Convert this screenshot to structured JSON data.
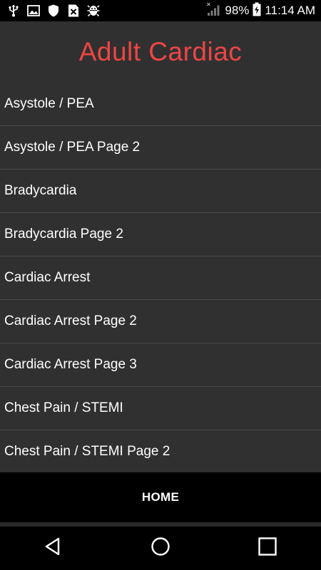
{
  "status_bar": {
    "icons_left": [
      "usb-icon",
      "image-icon",
      "shield-icon",
      "close-box-icon",
      "android-debug-icon"
    ],
    "signal_icon": "signal-icon",
    "battery_percent": "98%",
    "battery_icon": "battery-charging-icon",
    "time": "11:14 AM"
  },
  "header": {
    "title": "Adult Cardiac",
    "title_color": "#ef4545"
  },
  "list": {
    "items": [
      {
        "label": "Asystole / PEA"
      },
      {
        "label": "Asystole / PEA Page 2"
      },
      {
        "label": "Bradycardia"
      },
      {
        "label": "Bradycardia Page 2"
      },
      {
        "label": "Cardiac Arrest"
      },
      {
        "label": "Cardiac Arrest Page 2"
      },
      {
        "label": "Cardiac Arrest Page 3"
      },
      {
        "label": "Chest Pain / STEMI"
      },
      {
        "label": "Chest Pain / STEMI Page 2"
      }
    ]
  },
  "footer": {
    "home_label": "HOME"
  },
  "nav_bar": {
    "back_icon": "back-triangle-icon",
    "home_icon": "home-circle-icon",
    "recents_icon": "recents-square-icon"
  }
}
